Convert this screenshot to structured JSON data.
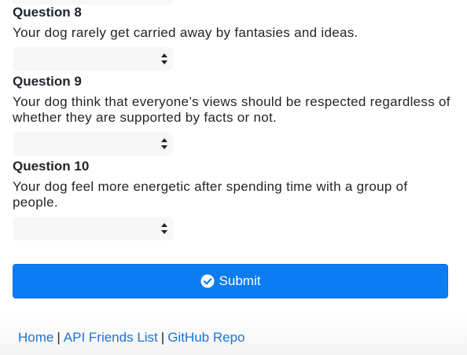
{
  "questions": [
    {
      "title": "Question 8",
      "text": "Your dog rarely get carried away by fantasies and ideas.",
      "selected_value": ""
    },
    {
      "title": "Question 9",
      "text": "Your dog think that everyone’s views should be respected regardless of whether they are supported by facts or not.",
      "selected_value": ""
    },
    {
      "title": "Question 10",
      "text": "Your dog feel more energetic after spending time with a group of people.",
      "selected_value": ""
    }
  ],
  "submit": {
    "label": "Submit",
    "icon": "check-circle-icon",
    "color": "#0d7cf2"
  },
  "footer": {
    "home": "Home",
    "separator": "|",
    "api_friends": "API Friends List",
    "github": "GitHub Repo",
    "link_color": "#1a73d9"
  }
}
